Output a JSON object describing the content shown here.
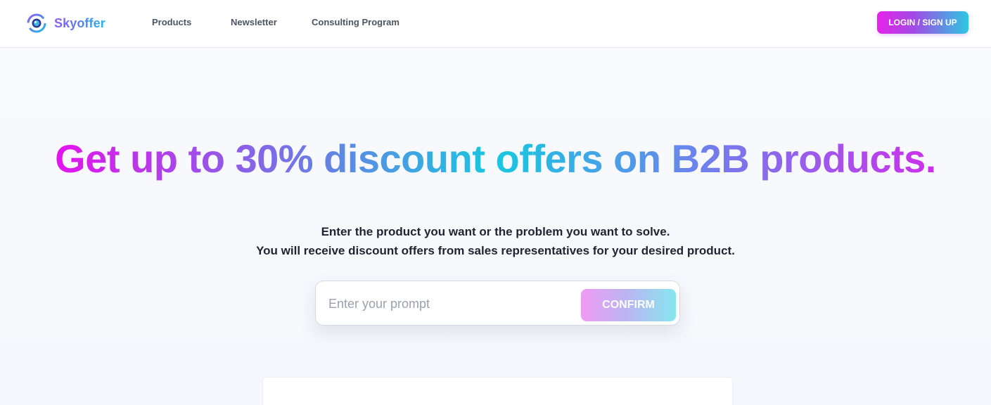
{
  "brand": {
    "name": "Skyoffer",
    "logo_icon": "skyoffer-logo-icon"
  },
  "nav": {
    "items": [
      {
        "label": "Products"
      },
      {
        "label": "Newsletter"
      },
      {
        "label": "Consulting Program"
      }
    ],
    "login_label": "LOGIN / SIGN UP"
  },
  "hero": {
    "headline": "Get up to 30% discount offers on B2B products.",
    "subline_1": "Enter the product you want or the problem you want to solve.",
    "subline_2": "You will receive discount offers from sales representatives for your desired product."
  },
  "prompt": {
    "placeholder": "Enter your prompt",
    "value": "",
    "confirm_label": "CONFIRM"
  },
  "colors": {
    "gradient_start": "#e215ee",
    "gradient_mid": "#19c7e0",
    "gradient_end": "#cc30ec",
    "text_dark": "#1f2430",
    "nav_text": "#4b5563"
  }
}
